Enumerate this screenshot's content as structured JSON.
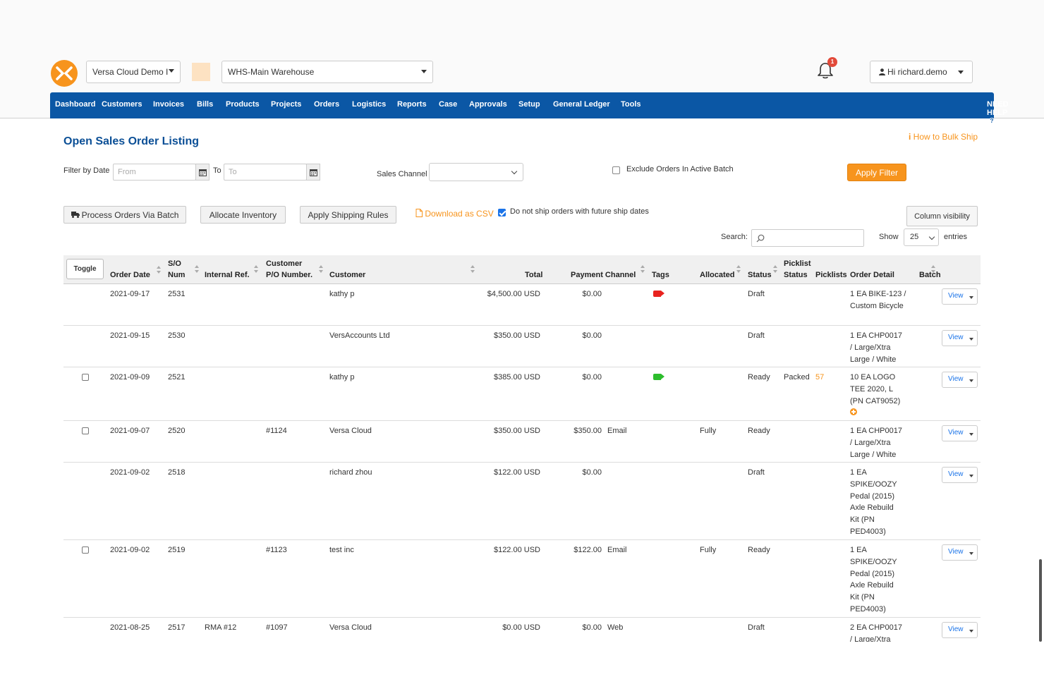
{
  "header": {
    "company": "Versa Cloud Demo I",
    "warehouse": "WHS-Main Warehouse",
    "notification_count": "1",
    "user": "Hi richard.demo"
  },
  "nav": {
    "items": [
      "Dashboard",
      "Customers",
      "Invoices",
      "Bills",
      "Products",
      "Projects",
      "Orders",
      "Logistics",
      "Reports",
      "Case",
      "Approvals",
      "Setup",
      "General Ledger",
      "Tools"
    ],
    "help": "NEED HELP"
  },
  "page": {
    "title": "Open Sales Order Listing",
    "bulk_ship_link": "How to Bulk Ship"
  },
  "filters": {
    "filter_by_date_label": "Filter by Date",
    "from_placeholder": "From",
    "to_label": "To",
    "to_placeholder": "To",
    "sales_channel_label": "Sales Channel",
    "sales_channel_value": "",
    "exclude_label": "Exclude Orders In Active Batch",
    "apply_label": "Apply Filter"
  },
  "actions": {
    "process_batch": "Process Orders Via Batch",
    "allocate": "Allocate Inventory",
    "apply_shipping": "Apply Shipping Rules",
    "download_csv": "Download as CSV",
    "no_future_label": "Do not ship orders with future ship dates",
    "column_visibility": "Column visibility",
    "search_label": "Search:",
    "show_label": "Show",
    "entries_value": "25",
    "entries_label": "entries"
  },
  "table": {
    "toggle_label": "Toggle",
    "headers": {
      "order_date": "Order Date",
      "so_num_1": "S/O",
      "so_num_2": "Num",
      "internal_ref": "Internal Ref.",
      "customer_po_1": "Customer",
      "customer_po_2": "P/O Number.",
      "customer": "Customer",
      "total": "Total",
      "payment_channel": "Payment Channel",
      "tags": "Tags",
      "allocated": "Allocated",
      "status": "Status",
      "picklist_status_1": "Picklist",
      "picklist_status_2": "Status",
      "picklists": "Picklists",
      "order_detail": "Order Detail",
      "batch": "Batch"
    },
    "view_label": "View",
    "rows": [
      {
        "date": "2021-09-17",
        "num": "2531",
        "ref": "",
        "po": "",
        "customer": "kathy p",
        "total": "$4,500.00 USD",
        "payment": "$0.00",
        "channel": "",
        "tag": "red",
        "allocated": "",
        "status": "Draft",
        "pick_status": "",
        "picklists": "",
        "detail": "1 EA BIKE-123 / Custom Bicycle",
        "checkbox": false
      },
      {
        "date": "2021-09-15",
        "num": "2530",
        "ref": "",
        "po": "",
        "customer": "VersAccounts Ltd",
        "total": "$350.00 USD",
        "payment": "$0.00",
        "channel": "",
        "tag": "",
        "allocated": "",
        "status": "Draft",
        "pick_status": "",
        "picklists": "",
        "detail": "1 EA CHP0017 / Large/Xtra Large / White",
        "checkbox": false
      },
      {
        "date": "2021-09-09",
        "num": "2521",
        "ref": "",
        "po": "",
        "customer": "kathy p",
        "total": "$385.00 USD",
        "payment": "$0.00",
        "channel": "",
        "tag": "green",
        "allocated": "",
        "status": "Ready",
        "pick_status": "Packed",
        "picklists": "57",
        "detail": "10 EA LOGO TEE 2020, L (PN CAT9052)",
        "checkbox": true
      },
      {
        "date": "2021-09-07",
        "num": "2520",
        "ref": "",
        "po": "#1124",
        "customer": "Versa Cloud",
        "total": "$350.00 USD",
        "payment": "$350.00",
        "channel": "Email",
        "tag": "",
        "allocated": "Fully",
        "status": "Ready",
        "pick_status": "",
        "picklists": "",
        "detail": "1 EA CHP0017 / Large/Xtra Large / White",
        "checkbox": true
      },
      {
        "date": "2021-09-02",
        "num": "2518",
        "ref": "",
        "po": "",
        "customer": "richard zhou",
        "total": "$122.00 USD",
        "payment": "$0.00",
        "channel": "",
        "tag": "",
        "allocated": "",
        "status": "Draft",
        "pick_status": "",
        "picklists": "",
        "detail": "1 EA SPIKE/OOZY Pedal (2015) Axle Rebuild Kit (PN PED4003)",
        "checkbox": false
      },
      {
        "date": "2021-09-02",
        "num": "2519",
        "ref": "",
        "po": "#1123",
        "customer": "test inc",
        "total": "$122.00 USD",
        "payment": "$122.00",
        "channel": "Email",
        "tag": "",
        "allocated": "Fully",
        "status": "Ready",
        "pick_status": "",
        "picklists": "",
        "detail": "1 EA SPIKE/OOZY Pedal (2015) Axle Rebuild Kit (PN PED4003)",
        "checkbox": true
      },
      {
        "date": "2021-08-25",
        "num": "2517",
        "ref": "RMA #12",
        "po": "#1097",
        "customer": "Versa Cloud",
        "total": "$0.00 USD",
        "payment": "$0.00",
        "channel": "Web",
        "tag": "",
        "allocated": "",
        "status": "Draft",
        "pick_status": "",
        "picklists": "",
        "detail": "2 EA CHP0017 / Large/Xtra",
        "checkbox": false
      }
    ]
  },
  "colors": {
    "nav_blue": "#0b57a5",
    "accent_orange": "#f7941d",
    "title_blue": "#0b4f96",
    "tag_red": "#e8231f",
    "tag_green": "#2dbd2d"
  }
}
